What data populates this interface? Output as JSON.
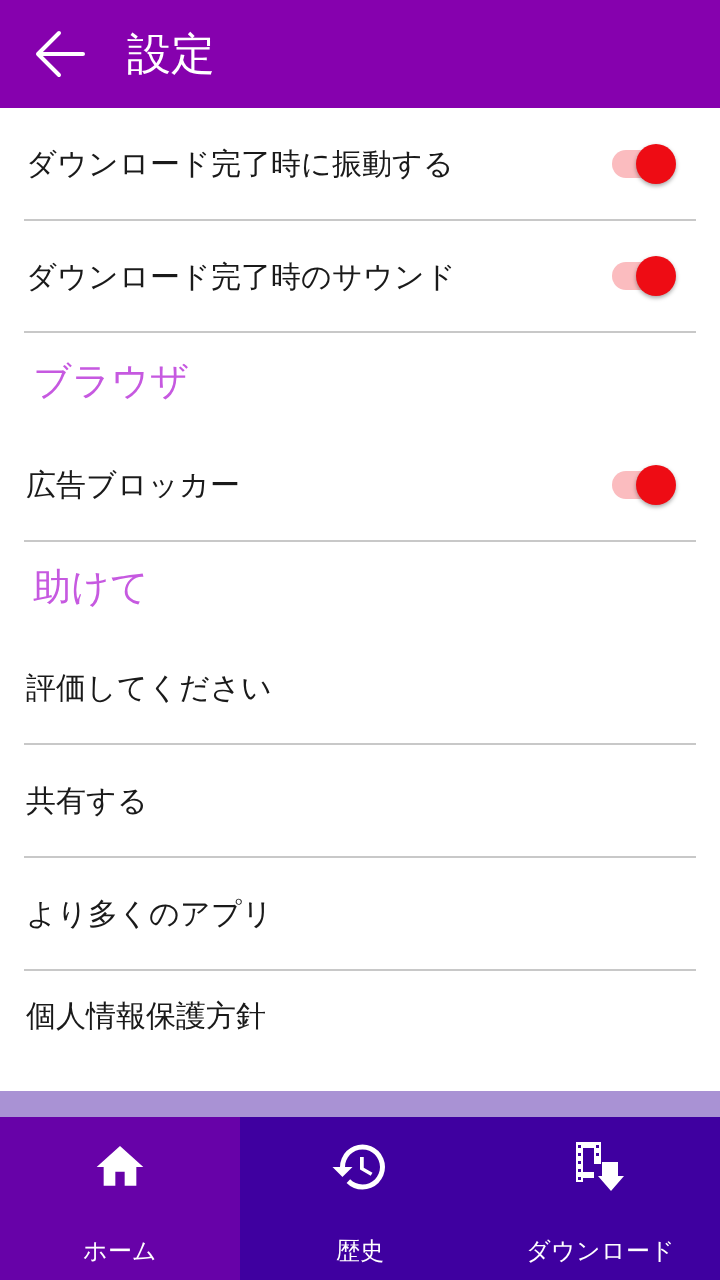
{
  "app_bar": {
    "title": "設定"
  },
  "sections": [
    {
      "items": [
        {
          "kind": "toggle",
          "label": "ダウンロード完了時に振動する",
          "on": true
        },
        {
          "kind": "toggle",
          "label": "ダウンロード完了時のサウンド",
          "on": true
        }
      ]
    },
    {
      "header": "ブラウザ",
      "items": [
        {
          "kind": "toggle",
          "label": "広告ブロッカー",
          "on": true
        }
      ]
    },
    {
      "header": "助けて",
      "items": [
        {
          "kind": "link",
          "label": "評価してください"
        },
        {
          "kind": "link",
          "label": "共有する"
        },
        {
          "kind": "link",
          "label": "より多くのアプリ"
        },
        {
          "kind": "link",
          "label": "個人情報保護方針"
        }
      ]
    }
  ],
  "bottom_nav": [
    {
      "label": "ホーム",
      "selected": true
    },
    {
      "label": "歴史",
      "selected": false
    },
    {
      "label": "ダウンロード",
      "selected": false
    }
  ]
}
